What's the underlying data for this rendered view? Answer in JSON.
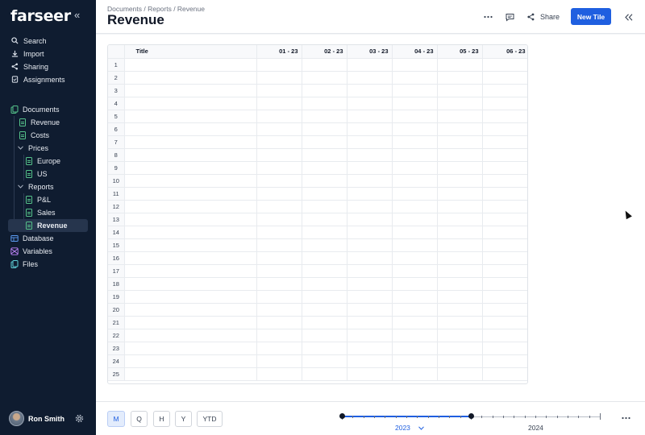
{
  "app": {
    "logo": "farseer"
  },
  "sidebar": {
    "top_items": [
      {
        "label": "Search",
        "icon": "search-icon"
      },
      {
        "label": "Import",
        "icon": "import-icon"
      },
      {
        "label": "Sharing",
        "icon": "share-icon"
      },
      {
        "label": "Assignments",
        "icon": "assignments-icon"
      }
    ],
    "tree": {
      "documents": "Documents",
      "revenue": "Revenue",
      "costs": "Costs",
      "prices": "Prices",
      "europe": "Europe",
      "us": "US",
      "reports": "Reports",
      "pl": "P&L",
      "sales": "Sales",
      "reports_revenue": "Revenue",
      "database": "Database",
      "variables": "Variables",
      "files": "Files"
    },
    "user": {
      "name": "Ron Smith"
    }
  },
  "header": {
    "breadcrumb": "Documents / Reports / Revenue",
    "title": "Revenue",
    "share_label": "Share",
    "new_tile_label": "New Tile"
  },
  "grid": {
    "title_header": "Title",
    "columns": [
      "01 - 23",
      "02 - 23",
      "03 - 23",
      "04 - 23",
      "05 - 23",
      "06 - 23"
    ],
    "rows": [
      "1",
      "2",
      "3",
      "4",
      "5",
      "6",
      "7",
      "8",
      "9",
      "10",
      "11",
      "12",
      "13",
      "14",
      "15",
      "16",
      "17",
      "18",
      "19",
      "20",
      "21",
      "22",
      "23",
      "24",
      "25"
    ]
  },
  "footer": {
    "periods": [
      "M",
      "Q",
      "H",
      "Y",
      "YTD"
    ],
    "active_period": "M",
    "year_2023": "2023",
    "year_2024": "2024"
  },
  "colors": {
    "sidebar_bg": "#0f1c30",
    "accent": "#1f5fe0",
    "doc_icon": "#55c28a",
    "database_icon": "#5b9bf0",
    "variables_icon": "#c084fc",
    "files_icon": "#5fd0d8"
  }
}
